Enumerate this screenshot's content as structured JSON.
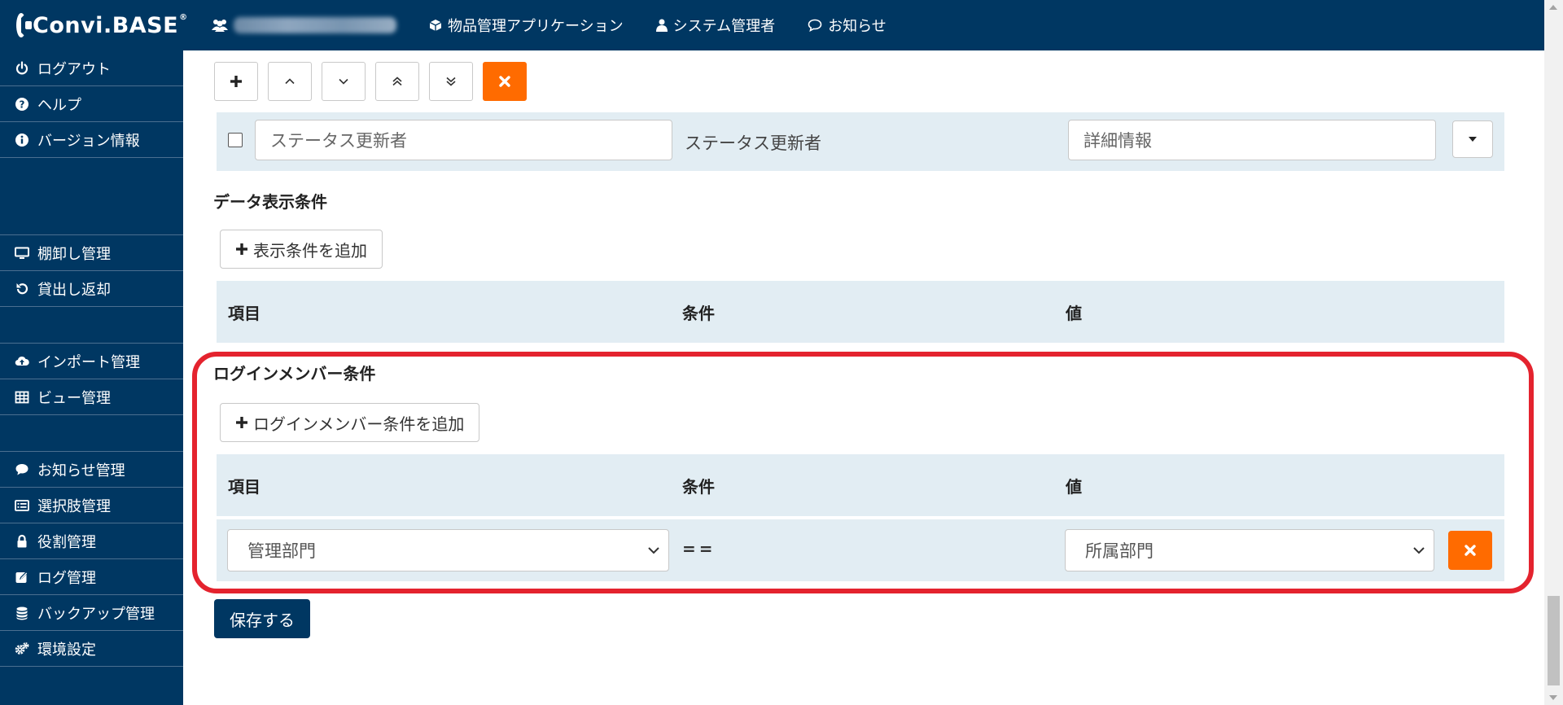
{
  "app": {
    "logo_text": "Convi.BASE",
    "logo_reg": "®"
  },
  "topnav": {
    "app_name": "物品管理アプリケーション",
    "user": "システム管理者",
    "notice": "お知らせ"
  },
  "sidebar": {
    "items": [
      {
        "label": "ログアウト",
        "icon": "power-icon"
      },
      {
        "label": "ヘルプ",
        "icon": "question-icon"
      },
      {
        "label": "バージョン情報",
        "icon": "info-icon"
      },
      {
        "label": "棚卸し管理",
        "icon": "monitor-icon"
      },
      {
        "label": "貸出し返却",
        "icon": "undo-icon"
      },
      {
        "label": "インポート管理",
        "icon": "cloud-upload-icon"
      },
      {
        "label": "ビュー管理",
        "icon": "table-icon"
      },
      {
        "label": "お知らせ管理",
        "icon": "comment-icon"
      },
      {
        "label": "選択肢管理",
        "icon": "list-icon"
      },
      {
        "label": "役割管理",
        "icon": "lock-icon"
      },
      {
        "label": "ログ管理",
        "icon": "edit-icon"
      },
      {
        "label": "バックアップ管理",
        "icon": "database-icon"
      },
      {
        "label": "環境設定",
        "icon": "cogs-icon"
      }
    ]
  },
  "field_row": {
    "name_value": "ステータス更新者",
    "display_label": "ステータス更新者",
    "detail_value": "詳細情報"
  },
  "display_conditions": {
    "title": "データ表示条件",
    "add_label": "表示条件を追加",
    "headers": [
      "項目",
      "条件",
      "値"
    ]
  },
  "login_conditions": {
    "title": "ログインメンバー条件",
    "add_label": "ログインメンバー条件を追加",
    "headers": [
      "項目",
      "条件",
      "値"
    ],
    "row": {
      "item": "管理部門",
      "operator": "==",
      "value": "所属部門"
    }
  },
  "save_label": "保存する",
  "colors": {
    "navy": "#003762",
    "orange": "#ff6b00",
    "panel": "#e2edf3",
    "highlight": "#e4232e"
  }
}
